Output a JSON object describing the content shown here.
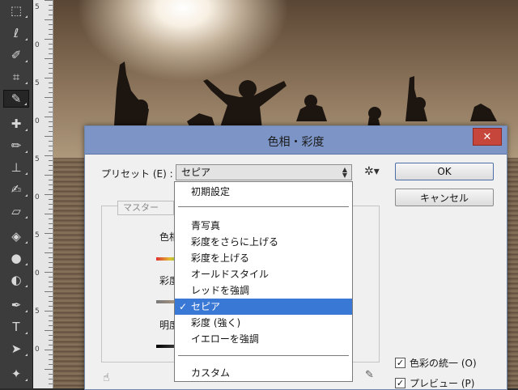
{
  "dialog": {
    "title": "色相・彩度",
    "close_label": "✕",
    "preset_label": "プリセット (E) :",
    "preset_value": "セピア",
    "ok_label": "OK",
    "cancel_label": "キャンセル",
    "channel_value": "マスター",
    "hue_label": "色相",
    "saturation_label": "彩度",
    "lightness_label": "明度",
    "colorize_label": "色彩の統一 (O)",
    "colorize_checked": true,
    "preview_label": "プレビュー (P)",
    "preview_checked": true
  },
  "dropdown": {
    "items": [
      "初期設定",
      "青写真",
      "彩度をさらに上げる",
      "彩度を上げる",
      "オールドスタイル",
      "レッドを強調",
      "セピア",
      "彩度 (強く)",
      "イエローを強調",
      "カスタム"
    ],
    "selected": "セピア"
  },
  "ruler": {
    "labels": [
      "5",
      "0",
      "5",
      "0",
      "5",
      "0",
      "5",
      "0",
      "5",
      "0"
    ]
  },
  "toolbar": {
    "tools": [
      "marquee-icon",
      "lasso-icon",
      "quick-selection-icon",
      "crop-icon",
      "eyedropper-icon",
      "spot-healing-icon",
      "brush-icon",
      "clone-stamp-icon",
      "history-brush-icon",
      "eraser-icon",
      "paint-bucket-icon",
      "blur-icon",
      "dodge-icon",
      "pen-icon",
      "type-icon",
      "path-selection-icon",
      "shape-icon"
    ]
  },
  "colors": {
    "titlebar": "#7d95c6",
    "selection": "#3a78d6",
    "close": "#c7463b"
  }
}
